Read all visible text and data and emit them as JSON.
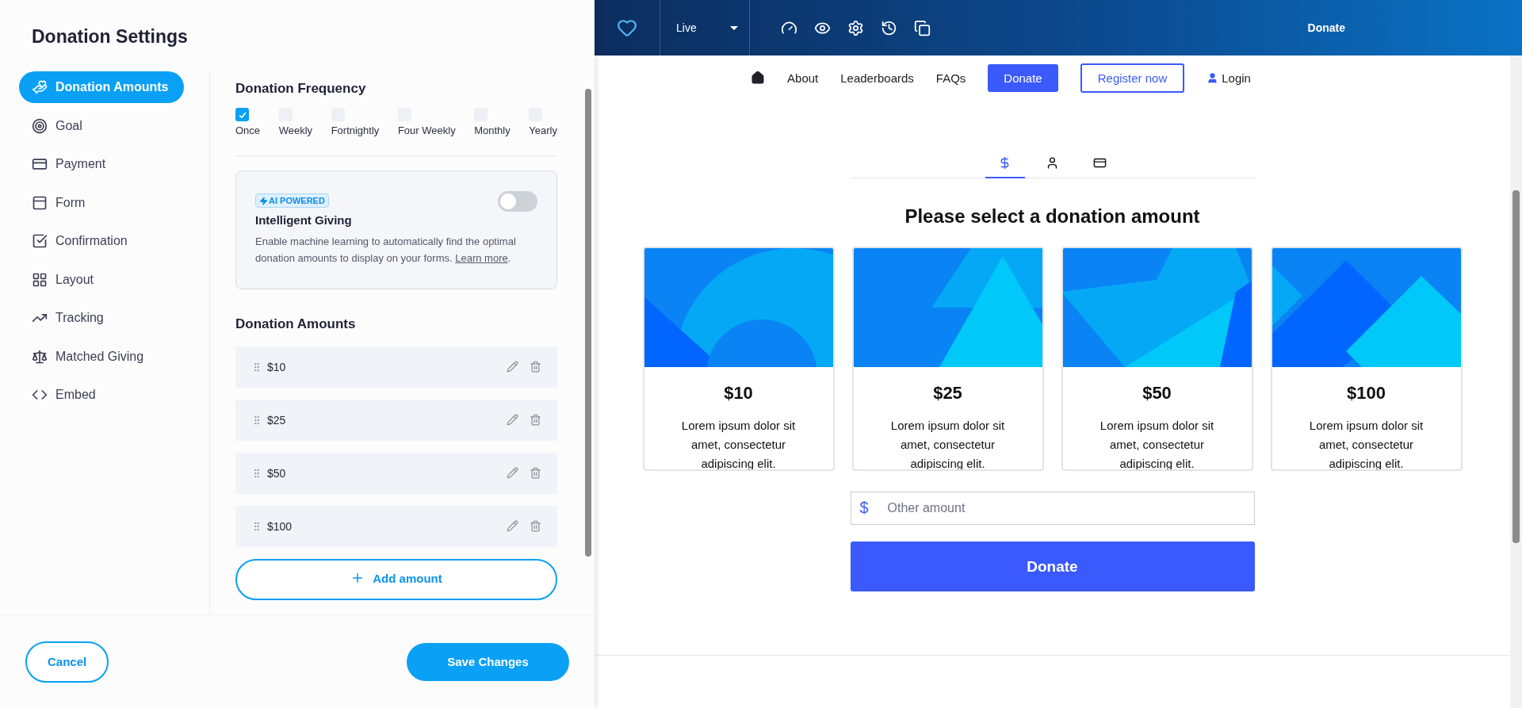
{
  "settings_panel": {
    "title": "Donation Settings",
    "nav": [
      {
        "label": "Donation Amounts",
        "selected": true
      },
      {
        "label": "Goal",
        "selected": false
      },
      {
        "label": "Payment",
        "selected": false
      },
      {
        "label": "Form",
        "selected": false
      },
      {
        "label": "Confirmation",
        "selected": false
      },
      {
        "label": "Layout",
        "selected": false
      },
      {
        "label": "Tracking",
        "selected": false
      },
      {
        "label": "Matched Giving",
        "selected": false
      },
      {
        "label": "Embed",
        "selected": false
      }
    ],
    "frequency": {
      "heading": "Donation Frequency",
      "options": [
        {
          "label": "Once",
          "checked": true
        },
        {
          "label": "Weekly",
          "checked": false
        },
        {
          "label": "Fortnightly",
          "checked": false
        },
        {
          "label": "Four Weekly",
          "checked": false
        },
        {
          "label": "Monthly",
          "checked": false
        },
        {
          "label": "Yearly",
          "checked": false
        }
      ]
    },
    "intelligent_giving": {
      "badge": "AI POWERED",
      "title": "Intelligent Giving",
      "description": "Enable machine learning to automatically find the optimal donation amounts to display on your forms.",
      "link": "Learn more",
      "link_suffix": ".",
      "on": false
    },
    "amounts": {
      "heading": "Donation Amounts",
      "items": [
        "$10",
        "$25",
        "$50",
        "$100"
      ],
      "add_button": "Add amount"
    },
    "footer": {
      "cancel": "Cancel",
      "save": "Save Changes"
    }
  },
  "toolbar": {
    "environment": "Live",
    "action": "Donate"
  },
  "preview": {
    "nav": [
      {
        "kind": "link",
        "label": "About"
      },
      {
        "kind": "link",
        "label": "Leaderboards"
      },
      {
        "kind": "link",
        "label": "FAQs"
      },
      {
        "kind": "primary",
        "label": "Donate"
      },
      {
        "kind": "outline",
        "label": "Register now"
      },
      {
        "kind": "login",
        "label": "Login"
      }
    ],
    "tabs": [
      {
        "kind": "amount",
        "selected": true
      },
      {
        "kind": "person",
        "selected": false
      },
      {
        "kind": "card",
        "selected": false
      }
    ],
    "heading": "Please select a donation amount",
    "cards": [
      {
        "amount": "$10",
        "text": "Lorem ipsum dolor sit amet, consectetur adipiscing elit."
      },
      {
        "amount": "$25",
        "text": "Lorem ipsum dolor sit amet, consectetur adipiscing elit."
      },
      {
        "amount": "$50",
        "text": "Lorem ipsum dolor sit amet, consectetur adipiscing elit."
      },
      {
        "amount": "$100",
        "text": "Lorem ipsum dolor sit amet, consectetur adipiscing elit."
      }
    ],
    "other_amount": {
      "prefix": "$",
      "placeholder": "Other amount"
    },
    "donate_button": "Donate"
  }
}
